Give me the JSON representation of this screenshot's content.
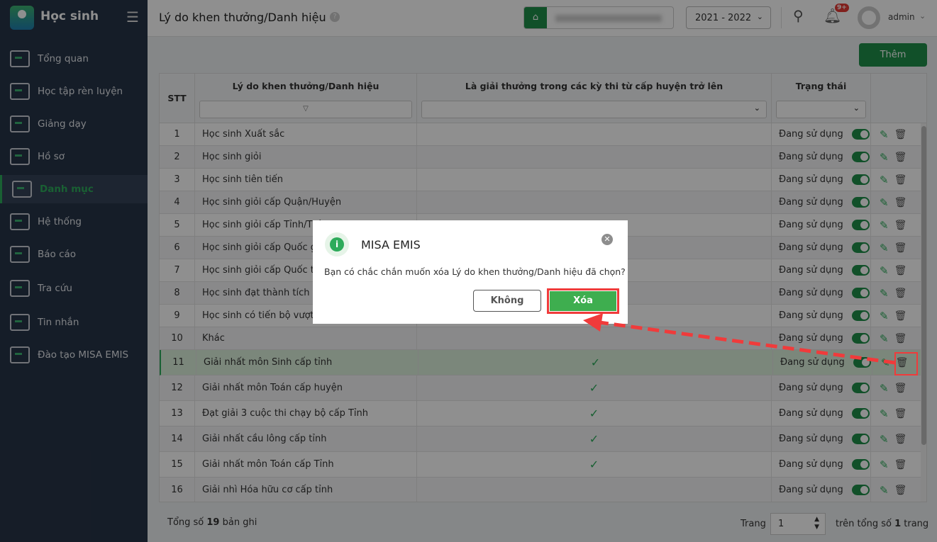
{
  "app": {
    "title": "Học sinh"
  },
  "sidebar": {
    "items": [
      {
        "label": "Tổng quan",
        "icon": "bar-chart-icon"
      },
      {
        "label": "Học tập rèn luyện",
        "icon": "book-icon"
      },
      {
        "label": "Giảng dạy",
        "icon": "board-icon"
      },
      {
        "label": "Hồ sơ",
        "icon": "document-icon"
      },
      {
        "label": "Danh mục",
        "icon": "folder-icon",
        "active": true
      },
      {
        "label": "Hệ thống",
        "icon": "gear-icon"
      },
      {
        "label": "Báo cáo",
        "icon": "pie-chart-icon"
      },
      {
        "label": "Tra cứu",
        "icon": "search-icon"
      },
      {
        "label": "Tin nhắn",
        "icon": "bell-icon"
      },
      {
        "label": "Đào tạo MISA EMIS",
        "icon": "box-icon"
      }
    ]
  },
  "header": {
    "title": "Lý do khen thưởng/Danh hiệu",
    "help": "?",
    "year": "2021 - 2022",
    "notif_badge": "9+",
    "user": "admin"
  },
  "toolbar": {
    "add_label": "Thêm"
  },
  "table": {
    "columns": [
      "STT",
      "Lý do khen thưởng/Danh hiệu",
      "Là giải thưởng trong các kỳ thi từ cấp huyện trở lên",
      "Trạng thái"
    ],
    "rows": [
      {
        "stt": "1",
        "name": "Học sinh Xuất sắc",
        "district": false,
        "status": "Đang sử dụng"
      },
      {
        "stt": "2",
        "name": "Học sinh giỏi",
        "district": false,
        "status": "Đang sử dụng"
      },
      {
        "stt": "3",
        "name": "Học sinh tiên tiến",
        "district": false,
        "status": "Đang sử dụng"
      },
      {
        "stt": "4",
        "name": "Học sinh giỏi cấp Quận/Huyện",
        "district": false,
        "status": "Đang sử dụng"
      },
      {
        "stt": "5",
        "name": "Học sinh giỏi cấp Tỉnh/Thà",
        "district": false,
        "status": "Đang sử dụng"
      },
      {
        "stt": "6",
        "name": "Học sinh giỏi cấp Quốc gia",
        "district": false,
        "status": "Đang sử dụng"
      },
      {
        "stt": "7",
        "name": "Học sinh giỏi cấp Quốc tế",
        "district": false,
        "status": "Đang sử dụng"
      },
      {
        "stt": "8",
        "name": "Học sinh đạt thành tích nổ",
        "district": false,
        "status": "Đang sử dụng"
      },
      {
        "stt": "9",
        "name": "Học sinh có tiến bộ vượt b",
        "district": false,
        "status": "Đang sử dụng"
      },
      {
        "stt": "10",
        "name": "Khác",
        "district": false,
        "status": "Đang sử dụng"
      },
      {
        "stt": "11",
        "name": "Giải nhất môn Sinh cấp tỉnh",
        "district": true,
        "status": "Đang sử dụng",
        "selected": true
      },
      {
        "stt": "12",
        "name": "Giải nhất môn Toán cấp huyện",
        "district": true,
        "status": "Đang sử dụng"
      },
      {
        "stt": "13",
        "name": "Đạt giải 3 cuộc thi chạy bộ cấp Tỉnh",
        "district": true,
        "status": "Đang sử dụng"
      },
      {
        "stt": "14",
        "name": "Giải nhất cầu lông cấp tỉnh",
        "district": true,
        "status": "Đang sử dụng"
      },
      {
        "stt": "15",
        "name": "Giải nhất môn Toán cấp Tỉnh",
        "district": true,
        "status": "Đang sử dụng"
      },
      {
        "stt": "16",
        "name": "Giải nhì Hóa hữu cơ cấp tỉnh",
        "district": false,
        "status": "Đang sử dụng"
      }
    ]
  },
  "footer": {
    "total_prefix": "Tổng số",
    "total": "19",
    "total_suffix": "bản ghi",
    "page_label": "Trang",
    "page": "1",
    "pages_prefix": "trên tổng số",
    "pages": "1",
    "pages_suffix": "trang"
  },
  "dialog": {
    "title": "MISA EMIS",
    "message": "Bạn có chắc chắn muốn xóa Lý do khen thưởng/Danh hiệu đã chọn?",
    "cancel": "Không",
    "confirm": "Xóa"
  },
  "colors": {
    "accent": "#1f8f4a",
    "highlight": "#f03b3b"
  }
}
